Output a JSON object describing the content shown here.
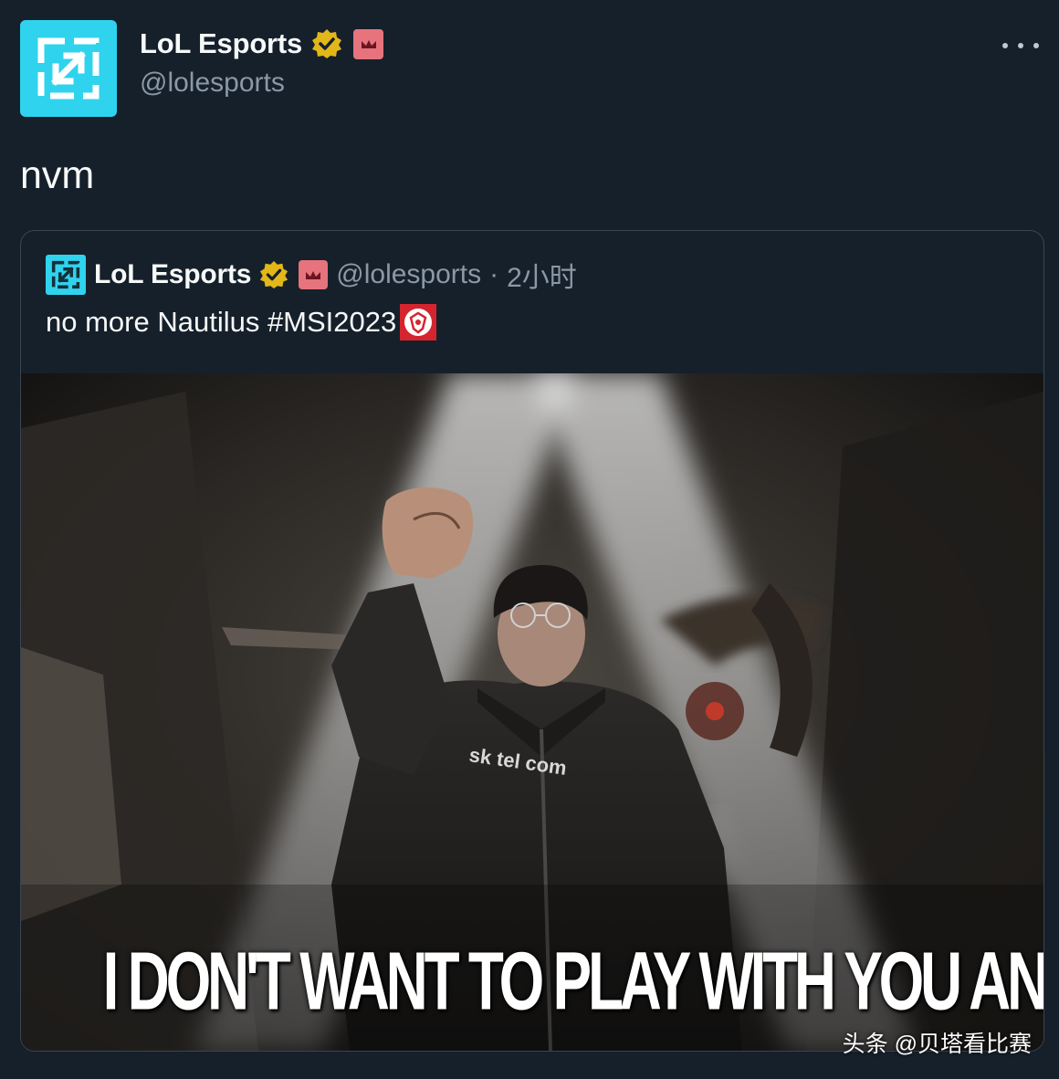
{
  "tweet": {
    "author_name": "LoL Esports",
    "author_handle": "@lolesports",
    "text": "nvm"
  },
  "quoted_tweet": {
    "author_name": "LoL Esports",
    "author_handle": "@lolesports",
    "separator": "·",
    "time": "2小时",
    "text": "no more Nautilus #MSI2023",
    "image_caption": "I DON'T WANT TO PLAY WITH YOU ANYMORE",
    "image_detail_text": "sk tel com"
  },
  "icons": {
    "avatar": "lol-esports-logo-icon",
    "verified": "gold-verified-badge-icon",
    "affiliate": "affiliate-badge-icon",
    "more": "more-options-icon",
    "emoji": "msi-emoji-icon"
  },
  "watermark": "头条 @贝塔看比赛",
  "colors": {
    "background": "#15202b",
    "avatar_bg": "#2fd3ee",
    "verified_gold": "#e2b719",
    "affiliate_pink": "#e7737d",
    "muted_text": "#8b98a5",
    "emoji_red": "#d4252f"
  }
}
